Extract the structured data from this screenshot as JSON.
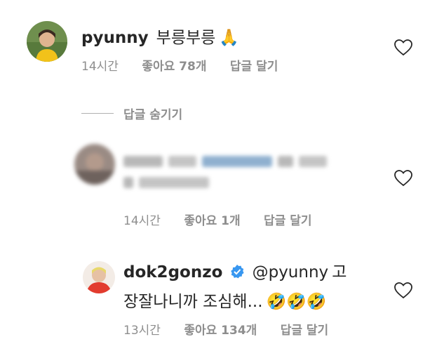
{
  "comments": [
    {
      "username": "pyunny",
      "text": "부릉부릉",
      "emoji": "🙏",
      "time": "14시간",
      "likes": "좋아요 78개",
      "reply": "답글 달기"
    },
    {
      "text_blurred": "████ ████ ███████ █ ██ ████",
      "time": "14시간",
      "likes": "좋아요 1개",
      "reply": "답글 달기"
    },
    {
      "username": "dok2gonzo",
      "mention": "@pyunny",
      "text_line1_tail": "고",
      "text_line2": "장잘나니까 조심해...",
      "emoji": "🤣🤣🤣",
      "time": "13시간",
      "likes": "좋아요 134개",
      "reply": "답글 달기"
    }
  ],
  "hide_replies": "답글 숨기기",
  "colors": {
    "verified": "#3897f0",
    "meta": "#8e8e8e",
    "text": "#262626"
  }
}
